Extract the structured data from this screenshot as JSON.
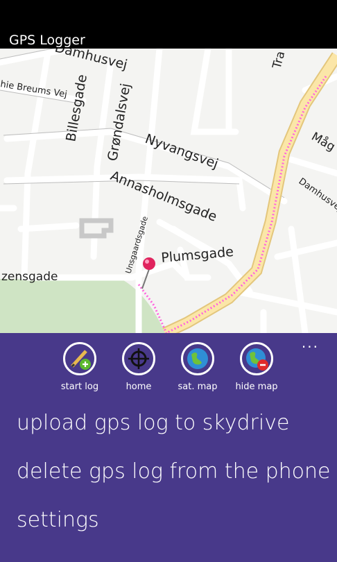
{
  "app": {
    "title": "GPS Logger"
  },
  "map": {
    "streets": {
      "damhusvej_top": "Damhusvej",
      "breums_vej": "hie Breums Vej",
      "billesgade": "Billesgade",
      "grondalsvej": "Grøndalsvej",
      "nyvangsvej": "Nyvangsvej",
      "annasholmsgade": "Annasholmsgade",
      "unsgaardsgade": "Unsgaardsgade",
      "plumsgade": "Plumsgade",
      "zensgade": "zensgade",
      "tra": "Tra",
      "mag": "Måg",
      "damhusvej_right": "Damhusvej"
    }
  },
  "appbar": {
    "more_label": "...",
    "buttons": [
      {
        "label": "start log",
        "icon": "pencil-add-icon"
      },
      {
        "label": "home",
        "icon": "crosshair-icon"
      },
      {
        "label": "sat. map",
        "icon": "globe-icon"
      },
      {
        "label": "hide map",
        "icon": "globe-remove-icon"
      }
    ],
    "menu_items": [
      {
        "label": "upload gps log to skydrive"
      },
      {
        "label": "delete gps log from the phone"
      },
      {
        "label": "settings"
      }
    ]
  },
  "colors": {
    "appbar": "#48398a",
    "track": "#ff66dd",
    "highway": "#fbe6a8",
    "park": "#cfe4c4"
  }
}
